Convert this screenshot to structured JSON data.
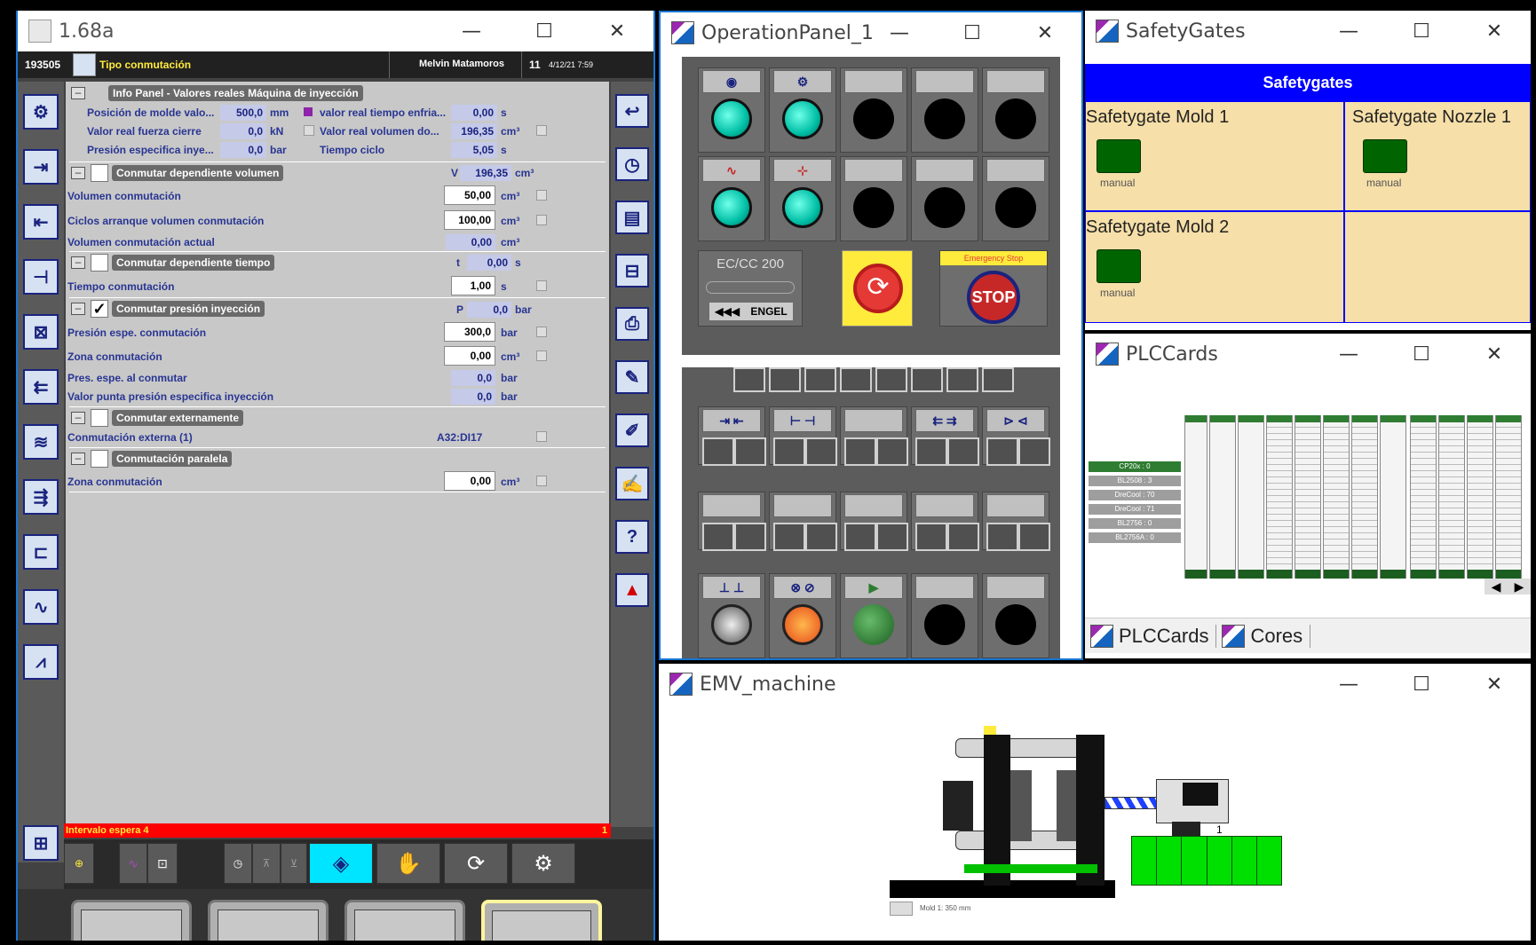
{
  "main_window": {
    "title": "1.68a",
    "header": {
      "id": "193505",
      "screen_title": "Tipo conmutación",
      "user": "Melvin Matamoros",
      "num": "11",
      "datetime": "4/12/21 7:59"
    },
    "info_panel": {
      "title": "Info Panel - Valores reales Máquina de inyección",
      "rows": [
        {
          "label": "Posición de molde valo...",
          "value": "500,0",
          "unit": "mm"
        },
        {
          "label": "Valor real fuerza cierre",
          "value": "0,0",
          "unit": "kN"
        },
        {
          "label": "Presión especifica inye...",
          "value": "0,0",
          "unit": "bar"
        },
        {
          "label": "valor real tiempo enfria...",
          "value": "0,00",
          "unit": "s"
        },
        {
          "label": "Valor real volumen do...",
          "value": "196,35",
          "unit": "cm³"
        },
        {
          "label": "Tiempo ciclo",
          "value": "5,05",
          "unit": "s"
        }
      ]
    },
    "sec_volumen": {
      "title": "Conmutar dependiente volumen",
      "symbol": "V",
      "value": "196,35",
      "unit": "cm³",
      "rows": [
        {
          "label": "Volumen conmutación",
          "value": "50,00",
          "unit": "cm³"
        },
        {
          "label": "Ciclos arranque volumen conmutación",
          "value": "100,00",
          "unit": "cm³"
        },
        {
          "label": "Volumen conmutación actual",
          "value": "0,00",
          "unit": "cm³"
        }
      ]
    },
    "sec_tiempo": {
      "title": "Conmutar dependiente tiempo",
      "symbol": "t",
      "value": "0,00",
      "unit": "s",
      "rows": [
        {
          "label": "Tiempo conmutación",
          "value": "1,00",
          "unit": "s"
        }
      ]
    },
    "sec_presion": {
      "title": "Conmutar presión inyección",
      "check": "✓",
      "symbol": "P",
      "value": "0,0",
      "unit": "bar",
      "rows": [
        {
          "label": "Presión espe. conmutación",
          "value": "300,0",
          "unit": "bar"
        },
        {
          "label": "Zona conmutación",
          "value": "0,00",
          "unit": "cm³"
        },
        {
          "label": "Pres. espe. al conmutar",
          "value": "0,0",
          "unit": "bar"
        },
        {
          "label": "Valor punta presión especifica inyección",
          "value": "0,0",
          "unit": "bar"
        }
      ]
    },
    "sec_externa": {
      "title": "Conmutar externamente",
      "rows": [
        {
          "label": "Conmutación externa (1)",
          "value": "A32:DI17"
        }
      ]
    },
    "sec_paralela": {
      "title": "Conmutación paralela",
      "rows": [
        {
          "label": "Zona conmutación",
          "value": "0,00",
          "unit": "cm³"
        }
      ]
    },
    "status_bar": {
      "text": "Intervalo espera 4",
      "count": "1"
    }
  },
  "operation_panel": {
    "title": "OperationPanel_1",
    "ec_label": "EC/CC 200",
    "engel_label": "ENGEL",
    "arrows_label": "◀◀◀",
    "emergency_label": "Emergency Stop",
    "stop_label": "STOP"
  },
  "safety_gates": {
    "title": "SafetyGates",
    "header": "Safetygates",
    "gates": [
      {
        "name": "Safetygate Mold 1",
        "mode": "manual"
      },
      {
        "name": "Safetygate Nozzle 1",
        "mode": "manual"
      },
      {
        "name": "Safetygate Mold 2",
        "mode": "manual"
      }
    ]
  },
  "plc_cards": {
    "title": "PLCCards",
    "list": [
      "CP20x : 0",
      "BL2508 : 3",
      "DreCool : 70",
      "DreCool : 71",
      "BL2756 : 0",
      "BL2756A : 0"
    ],
    "tabs": [
      "PLCCards",
      "Cores"
    ]
  },
  "emv_machine": {
    "title": "EMV_machine",
    "mold_label": "Mold 1: 350 mm",
    "nozzle_num": "1"
  },
  "window_controls": {
    "minimize": "—",
    "maximize": "☐",
    "close": "✕"
  },
  "colors": {
    "accent_blue": "#1976d2",
    "status_red": "#ff0000",
    "gate_green": "#006400",
    "safetygate_header": "#0000ff",
    "cyan_led": "#00bfa5"
  }
}
